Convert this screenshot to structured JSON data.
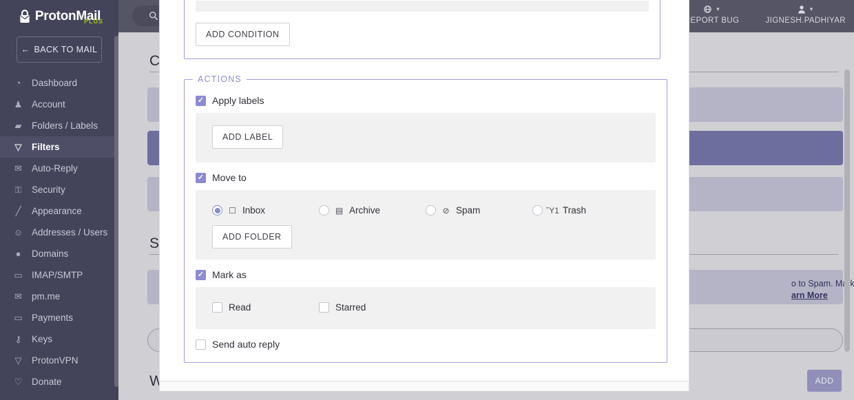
{
  "brand": {
    "name": "ProtonMail",
    "tier": "PLUS",
    "logo_icon": "proton-logo-icon"
  },
  "sidebar": {
    "back_label": "BACK TO MAIL",
    "back_icon": "arrow-left-icon",
    "items": [
      {
        "label": "Dashboard",
        "icon": "dashboard-icon",
        "glyph": "◔",
        "active": false
      },
      {
        "label": "Account",
        "icon": "user-icon",
        "glyph": "♟",
        "active": false
      },
      {
        "label": "Folders / Labels",
        "icon": "tag-icon",
        "glyph": "▰",
        "active": false
      },
      {
        "label": "Filters",
        "icon": "funnel-icon",
        "glyph": "▽",
        "active": true
      },
      {
        "label": "Auto-Reply",
        "icon": "envelope-open-icon",
        "glyph": "✉",
        "active": false
      },
      {
        "label": "Security",
        "icon": "lock-icon",
        "glyph": "⚿",
        "active": false
      },
      {
        "label": "Appearance",
        "icon": "brush-icon",
        "glyph": "╱",
        "active": false
      },
      {
        "label": "Addresses / Users",
        "icon": "users-icon",
        "glyph": "☺",
        "active": false
      },
      {
        "label": "Domains",
        "icon": "globe-icon",
        "glyph": "●",
        "active": false
      },
      {
        "label": "IMAP/SMTP",
        "icon": "monitor-icon",
        "glyph": "▭",
        "active": false
      },
      {
        "label": "pm.me",
        "icon": "envelope-icon",
        "glyph": "✉",
        "active": false
      },
      {
        "label": "Payments",
        "icon": "credit-card-icon",
        "glyph": "▭",
        "active": false
      },
      {
        "label": "Keys",
        "icon": "key-icon",
        "glyph": "⚷",
        "active": false
      },
      {
        "label": "ProtonVPN",
        "icon": "vpn-shield-icon",
        "glyph": "▽",
        "active": false
      },
      {
        "label": "Donate",
        "icon": "heart-icon",
        "glyph": "♡",
        "active": false
      }
    ]
  },
  "topbar": {
    "search_icon": "search-icon",
    "actions": [
      {
        "label": "REPORT BUG",
        "icon": "bug-icon",
        "glyph": "⚙"
      },
      {
        "label": "JIGNESH.PADHIYAR",
        "icon": "user-icon",
        "glyph": "♟"
      }
    ]
  },
  "background": {
    "headings": [
      {
        "text": "Custom filters"
      },
      {
        "text": "Spam filters"
      },
      {
        "text": "Whitelist"
      }
    ],
    "notice": {
      "line1": "o to Spam. Marking a",
      "link": "arn More"
    },
    "add_button": "ADD"
  },
  "modal": {
    "conditions": {
      "add_condition_label": "ADD CONDITION"
    },
    "actions": {
      "legend": "ACTIONS",
      "apply_labels": {
        "label": "Apply labels",
        "checked": true,
        "add_label_button": "ADD LABEL"
      },
      "move_to": {
        "label": "Move to",
        "checked": true,
        "add_folder_button": "ADD FOLDER",
        "options": [
          {
            "label": "Inbox",
            "icon": "inbox-icon",
            "glyph": "☐",
            "selected": true
          },
          {
            "label": "Archive",
            "icon": "archive-icon",
            "glyph": "▤",
            "selected": false
          },
          {
            "label": "Spam",
            "icon": "ban-icon",
            "glyph": "⊘",
            "selected": false
          },
          {
            "label": "Trash",
            "icon": "trash-icon",
            "glyph": "Ὕ1",
            "selected": false
          }
        ]
      },
      "mark_as": {
        "label": "Mark as",
        "checked": true,
        "options": [
          {
            "label": "Read",
            "checked": false
          },
          {
            "label": "Starred",
            "checked": false
          }
        ]
      },
      "send_auto_reply": {
        "label": "Send auto reply",
        "checked": false
      }
    }
  },
  "colors": {
    "accent": "#8b8bd4",
    "sidebar_bg": "#43435a",
    "topbar_bg": "#555565",
    "legend": "#8c8cd0",
    "plus_green": "#9bc614"
  }
}
